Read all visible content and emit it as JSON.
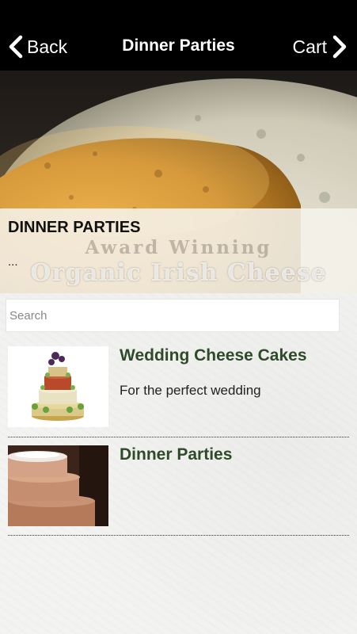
{
  "header": {
    "back_label": "Back",
    "title": "Dinner Parties",
    "cart_label": "Cart"
  },
  "hero": {
    "heading": "DINNER PARTIES",
    "subtext": "...",
    "overlay_line1": "Award Winning",
    "overlay_line2": "Organic Irish Cheese"
  },
  "search": {
    "placeholder": "Search"
  },
  "items": [
    {
      "title": "Wedding Cheese Cakes",
      "description": "For the perfect wedding"
    },
    {
      "title": "Dinner Parties",
      "description": ""
    }
  ],
  "colors": {
    "header_bg": "#000000",
    "item_title": "#2f4a2a",
    "page_bg": "#f3f3f1"
  }
}
